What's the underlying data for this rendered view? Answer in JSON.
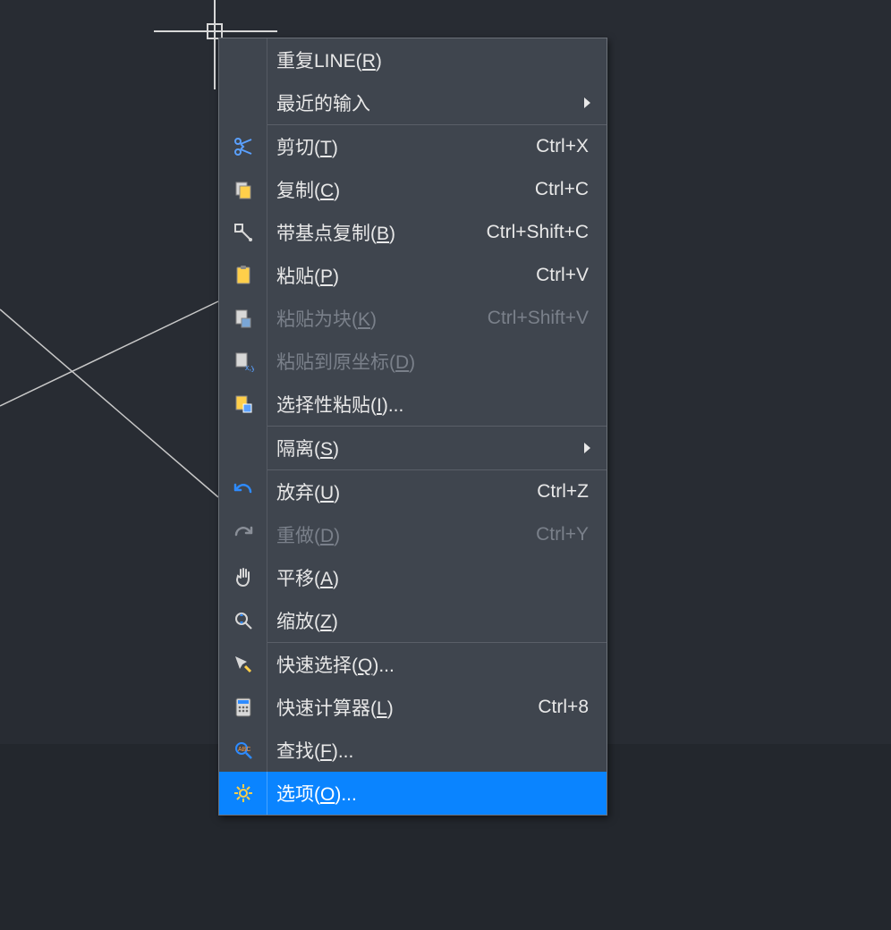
{
  "menu": {
    "items": [
      {
        "id": "repeat-line",
        "label_pre": "重复LINE(",
        "mn": "R",
        "label_post": ")",
        "shortcut": "",
        "icon": null,
        "disabled": false,
        "submenu": false
      },
      {
        "id": "recent-input",
        "label_pre": "最近的输入",
        "mn": "",
        "label_post": "",
        "shortcut": "",
        "icon": null,
        "disabled": false,
        "submenu": true
      },
      {
        "sep": true
      },
      {
        "id": "cut",
        "label_pre": "剪切(",
        "mn": "T",
        "label_post": ")",
        "shortcut": "Ctrl+X",
        "icon": "scissors-icon",
        "disabled": false,
        "submenu": false
      },
      {
        "id": "copy",
        "label_pre": "复制(",
        "mn": "C",
        "label_post": ")",
        "shortcut": "Ctrl+C",
        "icon": "copy-icon",
        "disabled": false,
        "submenu": false
      },
      {
        "id": "copy-base",
        "label_pre": "带基点复制(",
        "mn": "B",
        "label_post": ")",
        "shortcut": "Ctrl+Shift+C",
        "icon": "copy-base-icon",
        "disabled": false,
        "submenu": false
      },
      {
        "id": "paste",
        "label_pre": "粘贴(",
        "mn": "P",
        "label_post": ")",
        "shortcut": "Ctrl+V",
        "icon": "paste-icon",
        "disabled": false,
        "submenu": false
      },
      {
        "id": "paste-block",
        "label_pre": "粘贴为块(",
        "mn": "K",
        "label_post": ")",
        "shortcut": "Ctrl+Shift+V",
        "icon": "paste-block-icon",
        "disabled": true,
        "submenu": false
      },
      {
        "id": "paste-orig",
        "label_pre": "粘贴到原坐标(",
        "mn": "D",
        "label_post": ")",
        "shortcut": "",
        "icon": "paste-orig-icon",
        "disabled": true,
        "submenu": false
      },
      {
        "id": "paste-special",
        "label_pre": "选择性粘贴(",
        "mn": "I",
        "label_post": ")...",
        "shortcut": "",
        "icon": "paste-special-icon",
        "disabled": false,
        "submenu": false
      },
      {
        "sep": true
      },
      {
        "id": "isolate",
        "label_pre": "隔离(",
        "mn": "S",
        "label_post": ")",
        "shortcut": "",
        "icon": null,
        "disabled": false,
        "submenu": true
      },
      {
        "sep": true
      },
      {
        "id": "undo",
        "label_pre": "放弃(",
        "mn": "U",
        "label_post": ")",
        "shortcut": "Ctrl+Z",
        "icon": "undo-icon",
        "disabled": false,
        "submenu": false
      },
      {
        "id": "redo",
        "label_pre": "重做(",
        "mn": "D",
        "label_post": ")",
        "shortcut": "Ctrl+Y",
        "icon": "redo-icon",
        "disabled": true,
        "submenu": false
      },
      {
        "id": "pan",
        "label_pre": "平移(",
        "mn": "A",
        "label_post": ")",
        "shortcut": "",
        "icon": "pan-icon",
        "disabled": false,
        "submenu": false
      },
      {
        "id": "zoom",
        "label_pre": "缩放(",
        "mn": "Z",
        "label_post": ")",
        "shortcut": "",
        "icon": "zoom-icon",
        "disabled": false,
        "submenu": false
      },
      {
        "sep": true
      },
      {
        "id": "quick-select",
        "label_pre": "快速选择(",
        "mn": "Q",
        "label_post": ")...",
        "shortcut": "",
        "icon": "quick-select-icon",
        "disabled": false,
        "submenu": false
      },
      {
        "id": "quick-calc",
        "label_pre": "快速计算器(",
        "mn": "L",
        "label_post": ")",
        "shortcut": "Ctrl+8",
        "icon": "calculator-icon",
        "disabled": false,
        "submenu": false
      },
      {
        "id": "find",
        "label_pre": "查找(",
        "mn": "F",
        "label_post": ")...",
        "shortcut": "",
        "icon": "find-icon",
        "disabled": false,
        "submenu": false
      },
      {
        "id": "options",
        "label_pre": "选项(",
        "mn": "O",
        "label_post": ")...",
        "shortcut": "",
        "icon": "gear-icon",
        "disabled": false,
        "submenu": false,
        "highlight": true
      }
    ]
  },
  "colors": {
    "highlight": "#0a84ff",
    "menu_bg": "#3f454e",
    "canvas_bg": "#2a2e35"
  }
}
